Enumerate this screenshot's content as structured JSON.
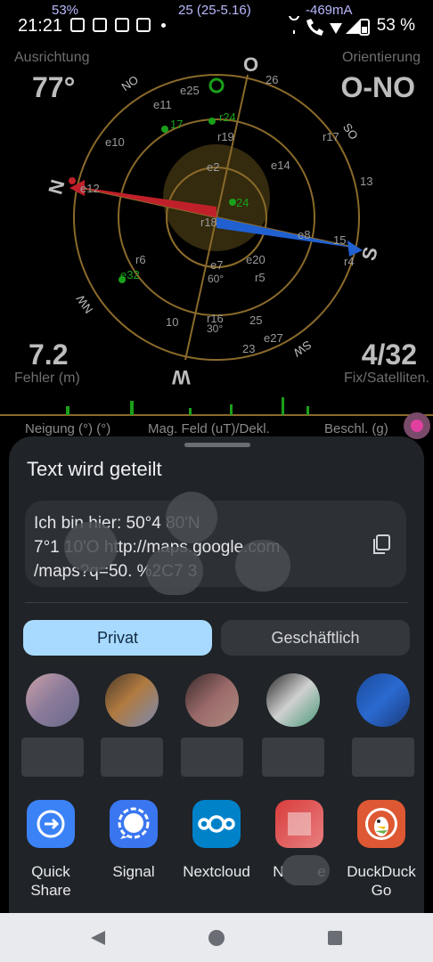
{
  "status_bar": {
    "time": "21:21",
    "overlay_percent": "53%",
    "overlay_fix": "25 (25-5.16)",
    "overlay_current": "-469mA",
    "battery": "53 %"
  },
  "gps": {
    "top_left_label": "Ausrichtung",
    "top_left_value": "77°",
    "top_right_label": "Orientierung",
    "top_right_value": "O-NO",
    "bottom_left_value": "7.2",
    "bottom_left_label": "Fehler (m)",
    "bottom_right_value": "4/32",
    "bottom_right_label": "Fix/Satelliten.",
    "bar_label_1": "Neigung (°) (°)",
    "bar_label_2": "Mag. Feld (uT)/Dekl.",
    "bar_label_3": "Beschl. (g)",
    "compass": {
      "n": "N",
      "s": "S",
      "o": "O",
      "w": "W",
      "no": "NO",
      "so": "SO",
      "sw": "SW",
      "nw": "NW"
    },
    "satellites": [
      "e25",
      "e11",
      "17",
      "r24",
      "r19",
      "e10",
      "e12",
      "e2",
      "24",
      "r18",
      "r6",
      "e32",
      "10",
      "r16",
      "30°",
      "e7",
      "60°",
      "e20",
      "r5",
      "25",
      "e27",
      "23",
      "26",
      "r17",
      "e14",
      "13",
      "e8",
      "15",
      "r4"
    ]
  },
  "share_sheet": {
    "title": "Text wird geteilt",
    "shared_text": "Ich bin hier: 50°4    80'N\n7°1    10'O http://maps.google.com\n/maps?q=50.    %2C7    3",
    "tabs": [
      {
        "label": "Privat",
        "active": true
      },
      {
        "label": "Geschäftlich",
        "active": false
      }
    ],
    "apps": [
      {
        "label": "Quick\nShare",
        "icon": "quick-share-icon",
        "color": "#3b82f6"
      },
      {
        "label": "Signal",
        "icon": "signal-icon",
        "color": "#3a76f0"
      },
      {
        "label": "Nextcloud",
        "icon": "nextcloud-icon",
        "color": "#0082c9"
      },
      {
        "label": "N        e",
        "icon": "app-icon-blurred",
        "color": "#d93c3c"
      },
      {
        "label": "DuckDuck\nGo",
        "icon": "duckduckgo-icon",
        "color": "#de5833"
      }
    ]
  }
}
